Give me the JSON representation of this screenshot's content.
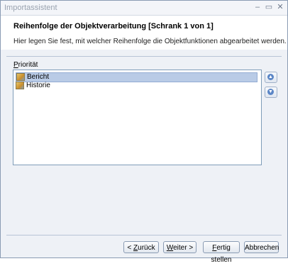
{
  "window": {
    "title": "Importassistent",
    "minimize": "–",
    "maximize": "▭",
    "close": "✕"
  },
  "header": {
    "title": "Reihenfolge der Objektverarbeitung [Schrank 1 von 1]",
    "description": "Hier legen Sie fest, mit welcher Reihenfolge die Objektfunktionen abgearbeitet werden."
  },
  "priority": {
    "label_underlined": "P",
    "label_rest": "riorität",
    "items": [
      {
        "label": "Bericht",
        "selected": true,
        "icon": "folder-document-icon"
      },
      {
        "label": "Historie",
        "selected": false,
        "icon": "folder-document-icon"
      }
    ]
  },
  "buttons": {
    "back_prefix": "< ",
    "back_underlined": "Z",
    "back_rest": "urück",
    "next_underlined": "W",
    "next_rest": "eiter >",
    "finish_underlined": "F",
    "finish_rest": "ertig stellen",
    "cancel": "Abbrechen"
  }
}
